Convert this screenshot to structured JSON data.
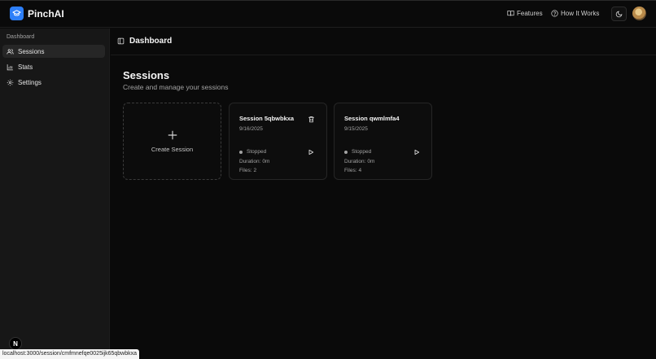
{
  "app": {
    "name": "PinchAI"
  },
  "topnav": {
    "features_label": "Features",
    "how_label": "How It Works"
  },
  "sidebar": {
    "section_label": "Dashboard",
    "items": [
      {
        "label": "Sessions",
        "icon": "users-icon",
        "active": true
      },
      {
        "label": "Stats",
        "icon": "bar-chart-icon",
        "active": false
      },
      {
        "label": "Settings",
        "icon": "gear-icon",
        "active": false
      }
    ]
  },
  "header": {
    "title": "Dashboard"
  },
  "page": {
    "title": "Sessions",
    "subtitle": "Create and manage your sessions"
  },
  "create_card": {
    "label": "Create Session"
  },
  "sessions": [
    {
      "title": "Session 5qbwbkxa",
      "date": "9/16/2025",
      "status": "Stopped",
      "duration_label": "Duration:",
      "duration": "0m",
      "files_label": "Files:",
      "files": "2",
      "has_delete": true
    },
    {
      "title": "Session qwmlmfa4",
      "date": "9/15/2025",
      "status": "Stopped",
      "duration_label": "Duration:",
      "duration": "0m",
      "files_label": "Files:",
      "files": "4",
      "has_delete": false
    }
  ],
  "status_url": "localhost:3000/session/cmfmnefqe0025ijk65qbwbkxa",
  "dev_badge": "N",
  "colors": {
    "accent": "#2d7ff9",
    "background": "#0a0a0a",
    "sidebar": "#171717"
  }
}
